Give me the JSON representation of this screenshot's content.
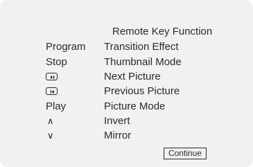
{
  "title": "Remote Key Function",
  "rows": [
    {
      "key": "Program",
      "function": "Transition Effect"
    },
    {
      "key": "Stop",
      "function": "Thumbnail Mode"
    },
    {
      "key_icon": "next-key-icon",
      "function": "Next Picture"
    },
    {
      "key_icon": "previous-key-icon",
      "function": "Previous Picture"
    },
    {
      "key": "Play",
      "function": "Picture Mode"
    },
    {
      "key_symbol": "∧",
      "function": "Invert"
    },
    {
      "key_symbol": "∨",
      "function": "Mirror"
    }
  ],
  "continue_label": "Continue"
}
